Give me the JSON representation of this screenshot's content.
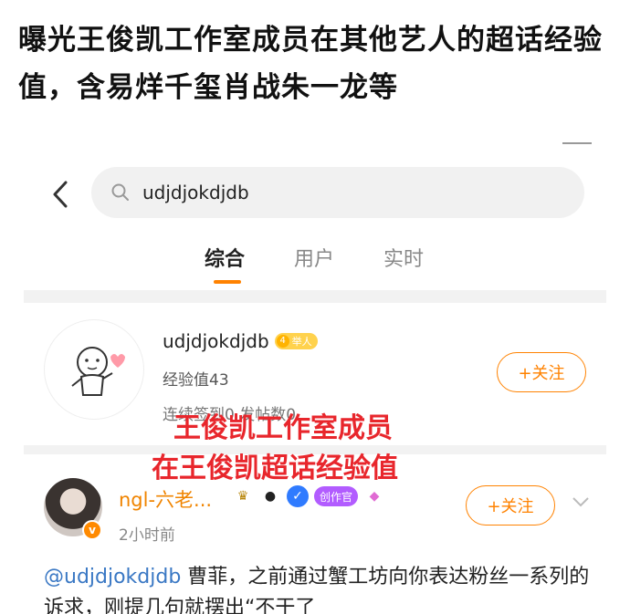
{
  "headline": "曝光王俊凯工作室成员在其他艺人的超话经验值，含易烊千玺肖战朱一龙等",
  "search": {
    "value": "udjdjokdjdb"
  },
  "tabs": [
    {
      "label": "综合",
      "active": true
    },
    {
      "label": "用户",
      "active": false
    },
    {
      "label": "实时",
      "active": false
    }
  ],
  "user_card": {
    "username": "udjdjokdjdb",
    "level_badge": {
      "level": "4",
      "text": "举人"
    },
    "exp_text": "经验值43",
    "stats_text": "连续签到0 发帖数0",
    "follow_label": "+关注"
  },
  "overlay": {
    "line1": "王俊凯工作室成员",
    "line2": "在王俊凯超话经验值",
    "color": "#e8262c"
  },
  "post": {
    "author": "ngl-六老...",
    "verified_mark": "v",
    "time": "2小时前",
    "follow_label": "+关注",
    "badge_icons": [
      "crown-icon",
      "panda-icon",
      "shield-icon",
      "creator-badge",
      "gem-icon"
    ],
    "creator_badge_text": "创作官",
    "mention": "@udjdjokdjdb",
    "text": " 曹菲，之前通过蟹工坊向你表达粉丝一系列的诉求，刚提几句就摆出“不干了"
  },
  "colors": {
    "accent": "#ff8200",
    "mention": "#3a78c4"
  }
}
